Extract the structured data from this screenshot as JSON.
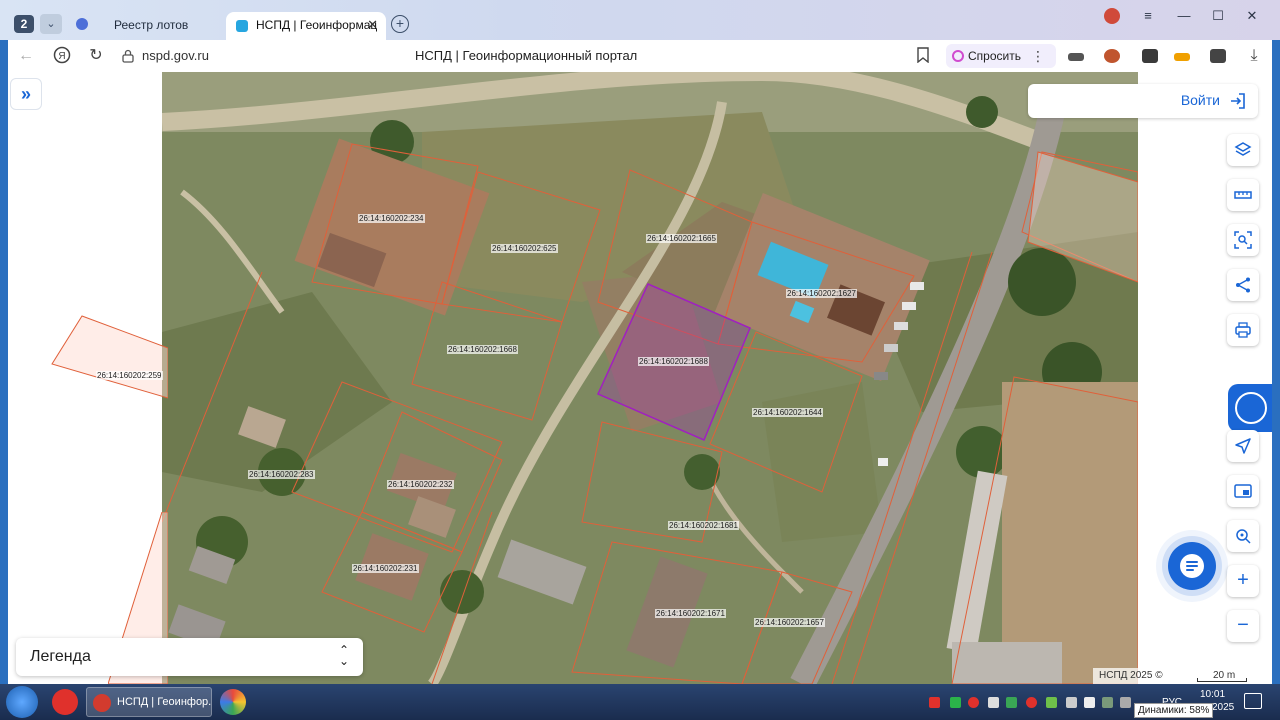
{
  "browser": {
    "tab_count": "2",
    "tabs": [
      {
        "label": "Реестр лотов",
        "active": false
      },
      {
        "label": "НСПД | Геоинформац",
        "active": true
      }
    ],
    "url": "nspd.gov.ru",
    "page_title": "НСПД | Геоинформационный портал",
    "ask_label": "Спросить"
  },
  "map": {
    "login_label": "Войти",
    "legend_label": "Легенда",
    "copyright": "НСПД 2025 ©",
    "scale_label": "20 m",
    "parcels": [
      {
        "id": "26:14:160202:234"
      },
      {
        "id": "26:14:160202:625"
      },
      {
        "id": "26:14:160202:1665"
      },
      {
        "id": "26:14:160202:1627"
      },
      {
        "id": "26:14:160202:1668"
      },
      {
        "id": "26:14:160202:1688"
      },
      {
        "id": "26:14:160202:259"
      },
      {
        "id": "26:14:160202:1644"
      },
      {
        "id": "26:14:160202:283"
      },
      {
        "id": "26:14:160202:232"
      },
      {
        "id": "26:14:160202:1681"
      },
      {
        "id": "26:14:160202:231"
      },
      {
        "id": "26:14:160202:1671"
      },
      {
        "id": "26:14:160202:1657"
      }
    ],
    "highlight_color": "#a020c0",
    "boundary_color": "#e0603a"
  },
  "taskbar": {
    "window_label": "НСПД | Геоинфор...",
    "clock_time": "10:01",
    "clock_year": "2025",
    "tray_text": "РУС",
    "tooltip": "Динамики: 58%"
  }
}
